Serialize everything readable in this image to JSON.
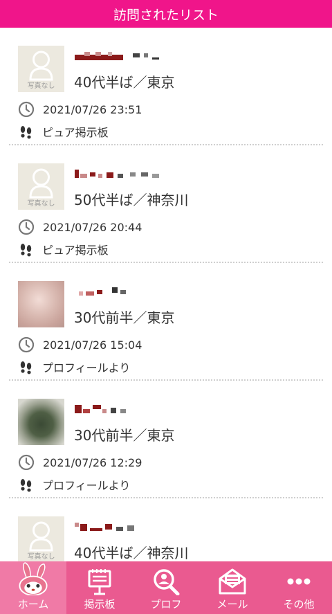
{
  "header": {
    "title": "訪問されたリスト"
  },
  "avatar": {
    "no_photo_label": "写真なし"
  },
  "visits": [
    {
      "photo": "none",
      "profile": "40代半ば／東京",
      "time": "2021/07/26 23:51",
      "source": "ピュア掲示板"
    },
    {
      "photo": "none",
      "profile": "50代半ば／神奈川",
      "time": "2021/07/26 20:44",
      "source": "ピュア掲示板"
    },
    {
      "photo": "blurred",
      "profile": "30代前半／東京",
      "time": "2021/07/26 15:04",
      "source": "プロフィールより"
    },
    {
      "photo": "blurred",
      "profile": "30代前半／東京",
      "time": "2021/07/26 12:29",
      "source": "プロフィールより"
    },
    {
      "photo": "none",
      "profile": "40代半ば／神奈川",
      "time": "",
      "source": ""
    }
  ],
  "tabbar": {
    "items": [
      {
        "label": "ホーム",
        "icon": "rabbit-mascot-icon"
      },
      {
        "label": "掲示板",
        "icon": "bulletin-board-icon"
      },
      {
        "label": "プロフ",
        "icon": "profile-search-icon"
      },
      {
        "label": "メール",
        "icon": "mail-icon"
      },
      {
        "label": "その他",
        "icon": "more-icon"
      }
    ]
  },
  "colors": {
    "header_bg": "#f0158a",
    "tabbar_bg": "#ea5a90",
    "name_mosaic": "#8b1a1a"
  }
}
